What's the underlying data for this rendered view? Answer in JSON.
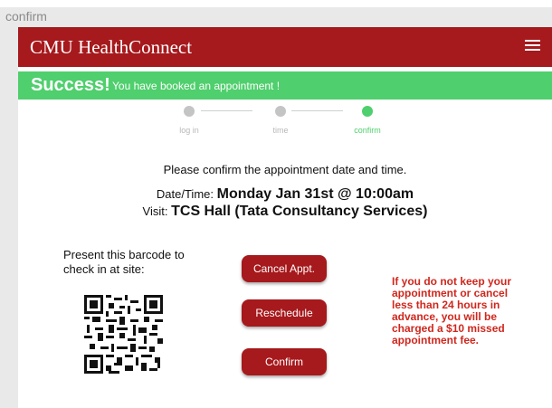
{
  "frame_label": "confirm",
  "top_fragment": "",
  "header": {
    "title": "CMU HealthConnect",
    "menu_icon": "hamburger-menu-icon"
  },
  "alert": {
    "strong": "Success!",
    "message": "You have booked an appointment !",
    "color": "#4fcf6d"
  },
  "steps": [
    {
      "label": "log in",
      "state": "done"
    },
    {
      "label": "time",
      "state": "done"
    },
    {
      "label": "confirm",
      "state": "active"
    }
  ],
  "prompt": "Please confirm the appointment date and time.",
  "appointment": {
    "datetime_label": "Date/Time:",
    "datetime_value": "Monday Jan 31st @ 10:00am",
    "visit_label": "Visit:",
    "visit_value": "TCS Hall (Tata Consultancy Services)"
  },
  "barcode": {
    "instruction": "Present this barcode to check in at site:"
  },
  "buttons": {
    "cancel": "Cancel Appt.",
    "reschedule": "Reschedule",
    "confirm": "Confirm"
  },
  "warning": "If you do not keep your appointment or cancel less than 24 hours in advance, you will be charged a $10 missed appointment fee.",
  "colors": {
    "brand": "#a6191c",
    "success": "#4fcf6d",
    "warning": "#d0271d"
  }
}
